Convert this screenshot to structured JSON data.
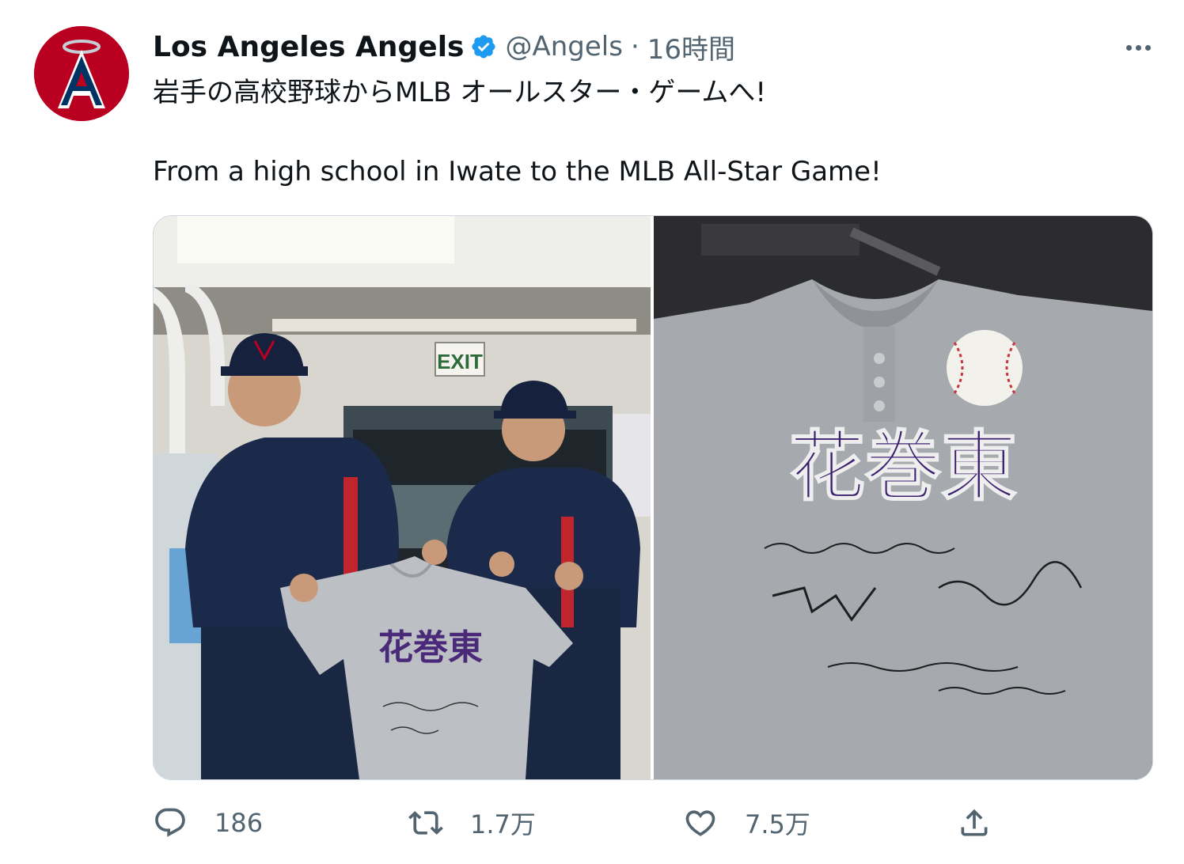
{
  "account": {
    "name": "Los Angeles Angels",
    "handle": "@Angels",
    "separator": "·",
    "time": "16時間",
    "verified": true,
    "brand_color": "#ba0021"
  },
  "tweet": {
    "line_ja": "岩手の高校野球からMLB オールスター・ゲームへ!",
    "line_en": "From a high school in Iwate to the MLB All-Star Game!"
  },
  "media": {
    "left_photo": {
      "exit_sign": "EXIT",
      "jersey_text": "花巻東"
    },
    "right_photo": {
      "jersey_text": "花巻東"
    }
  },
  "actions": {
    "reply": {
      "icon": "reply-icon",
      "count": "186"
    },
    "retweet": {
      "icon": "retweet-icon",
      "count": "1.7万"
    },
    "like": {
      "icon": "heart-icon",
      "count": "7.5万"
    },
    "share": {
      "icon": "share-icon"
    }
  },
  "icons": {
    "more": "more-icon",
    "verified": "verified-badge-icon",
    "avatar": "angels-logo-icon"
  },
  "colors": {
    "text_primary": "#0f1419",
    "text_secondary": "#536471",
    "verified_blue": "#1d9bf0",
    "border": "#cfd9de"
  }
}
